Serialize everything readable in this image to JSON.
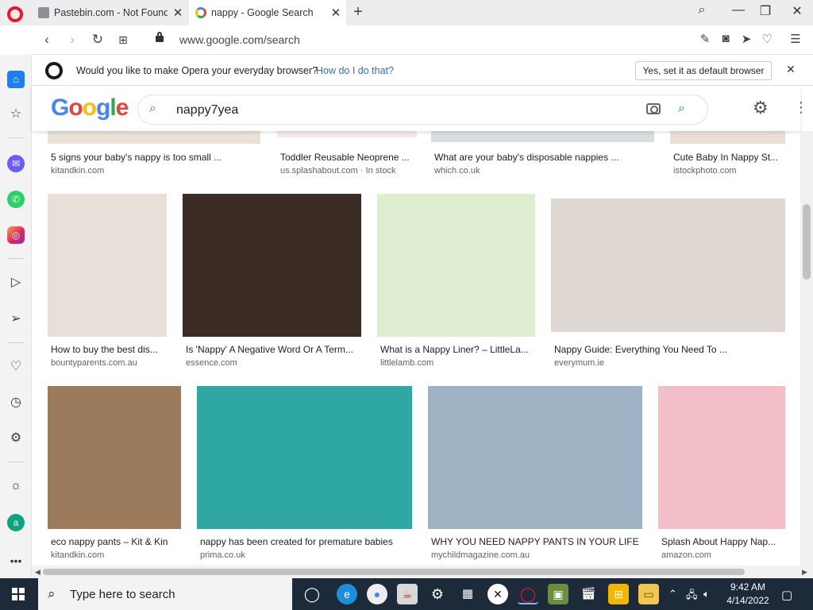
{
  "browser": {
    "tabs": [
      {
        "title": "Pastebin.com - Not Found"
      },
      {
        "title": "nappy - Google Search"
      }
    ],
    "url": "www.google.com/search",
    "infobar": {
      "message": "Would you like to make Opera your everyday browser?",
      "link": "How do I do that?",
      "button": "Yes, set it as default browser"
    }
  },
  "google": {
    "query": "nappy7yea"
  },
  "results": {
    "row1": [
      {
        "caption": "5 signs your baby's nappy is too small ...",
        "source": "kitandkin.com",
        "color": "#e9e1d6"
      },
      {
        "caption": "Toddler Reusable Neoprene ...",
        "source": "us.splashabout.com · In stock",
        "color": "#f2e8ea"
      },
      {
        "caption": "What are your baby's disposable nappies ...",
        "source": "which.co.uk",
        "color": "#d8dde0"
      },
      {
        "caption": "Cute Baby In Nappy St...",
        "source": "istockphoto.com",
        "color": "#eadfd4"
      }
    ],
    "row2": [
      {
        "caption": "How to buy the best dis...",
        "source": "bountyparents.com.au",
        "color": "#e6e0d8"
      },
      {
        "caption": "Is 'Nappy' A Negative Word Or A Term...",
        "source": "essence.com",
        "color": "#3b2d26"
      },
      {
        "caption": "What is a Nappy Liner? – LittleLa...",
        "source": "littlelamb.com",
        "color": "#dfeed0"
      },
      {
        "caption": "Nappy Guide: Everything You Need To ...",
        "source": "everymum.ie",
        "color": "#ded7d2"
      }
    ],
    "row3": [
      {
        "caption": "eco nappy pants – Kit & Kin",
        "source": "kitandkin.com",
        "color": "#9c7a5c"
      },
      {
        "caption": "nappy has been created for premature babies",
        "source": "prima.co.uk",
        "color": "#2fa7a3"
      },
      {
        "caption": "WHY YOU NEED NAPPY PANTS IN YOUR LIFE ...",
        "source": "mychildmagazine.com.au",
        "color": "#9fb3c5"
      },
      {
        "caption": "Splash About Happy Nap...",
        "source": "amazon.com",
        "color": "#f2bfc8"
      }
    ]
  },
  "taskbar": {
    "search_placeholder": "Type here to search",
    "time": "9:42 AM",
    "date": "4/14/2022"
  }
}
